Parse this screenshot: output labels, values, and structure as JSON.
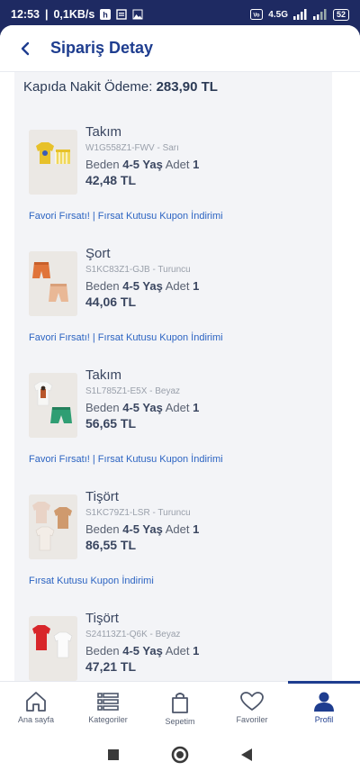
{
  "status": {
    "time": "12:53",
    "speed": "0,1KB/s",
    "network": "4.5G",
    "battery": "52"
  },
  "header": {
    "title": "Sipariş Detay"
  },
  "payment": {
    "label": "Kapıda Nakit Ödeme:",
    "amount": "283,90 TL"
  },
  "items": [
    {
      "name": "Takım",
      "code": "W1G558Z1-FWV - Sarı",
      "size_label": "Beden",
      "size": "4-5 Yaş",
      "qty_label": "Adet",
      "qty": "1",
      "price": "42,48 TL",
      "promo": "Favori Fırsatı! | Fırsat Kutusu Kupon İndirimi"
    },
    {
      "name": "Şort",
      "code": "S1KC83Z1-GJB - Turuncu",
      "size_label": "Beden",
      "size": "4-5 Yaş",
      "qty_label": "Adet",
      "qty": "1",
      "price": "44,06 TL",
      "promo": "Favori Fırsatı! | Fırsat Kutusu Kupon İndirimi"
    },
    {
      "name": "Takım",
      "code": "S1L785Z1-E5X - Beyaz",
      "size_label": "Beden",
      "size": "4-5 Yaş",
      "qty_label": "Adet",
      "qty": "1",
      "price": "56,65 TL",
      "promo": "Favori Fırsatı! | Fırsat Kutusu Kupon İndirimi"
    },
    {
      "name": "Tişört",
      "code": "S1KC79Z1-LSR - Turuncu",
      "size_label": "Beden",
      "size": "4-5 Yaş",
      "qty_label": "Adet",
      "qty": "1",
      "price": "86,55 TL",
      "promo": "Fırsat Kutusu Kupon İndirimi"
    },
    {
      "name": "Tişört",
      "code": "S24113Z1-Q6K - Beyaz",
      "size_label": "Beden",
      "size": "4-5 Yaş",
      "qty_label": "Adet",
      "qty": "1",
      "price": "47,21 TL",
      "promo": ""
    }
  ],
  "nav": {
    "items": [
      {
        "label": "Ana sayfa",
        "icon": "home-icon"
      },
      {
        "label": "Kategoriler",
        "icon": "categories-icon"
      },
      {
        "label": "Sepetim",
        "icon": "cart-bag-icon"
      },
      {
        "label": "Favoriler",
        "icon": "heart-icon"
      },
      {
        "label": "Profil",
        "icon": "profile-icon"
      }
    ],
    "active": "Profil"
  },
  "colors": {
    "brand": "#1e3d8f",
    "promo": "#2c64c2",
    "panel": "#f3f4f7"
  }
}
